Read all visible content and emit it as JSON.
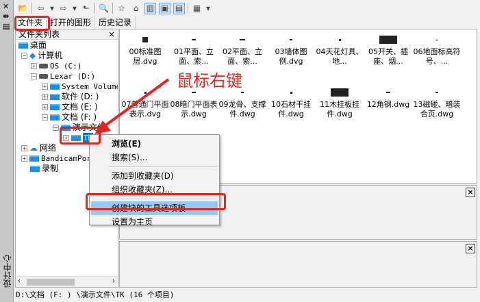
{
  "sidebar_strip": {
    "vertical_title": "设计中心"
  },
  "tabs": [
    {
      "label": "文件夹"
    },
    {
      "label": "打开的图形"
    },
    {
      "label": "历史记录"
    }
  ],
  "tree": {
    "header": "文件夹列表",
    "close": "×",
    "nodes": [
      {
        "label": "桌面"
      },
      {
        "label": "计算机"
      },
      {
        "label": "OS (C:)"
      },
      {
        "label": "Lexar (D:)"
      },
      {
        "label": "System Volume"
      },
      {
        "label": "软件 (D: )"
      },
      {
        "label": "文档 (E: )"
      },
      {
        "label": "文档 (F: )"
      },
      {
        "label": "演示文件"
      },
      {
        "label": "TK"
      },
      {
        "label": "网络"
      },
      {
        "label": "BandicamPor"
      },
      {
        "label": "录制"
      }
    ]
  },
  "content": {
    "items": [
      {
        "label": "00标准图层.dvg"
      },
      {
        "label": "01平面、立面、索..."
      },
      {
        "label": "02平面、立面、索..."
      },
      {
        "label": "03墙体图例.dvg"
      },
      {
        "label": "04天花灯具、地..."
      },
      {
        "label": "05开关、插座、烟..."
      },
      {
        "label": "06地面标高符号、..."
      },
      {
        "label": "07普通门平面表示.dvg"
      },
      {
        "label": "08暗门平面表示.dwg"
      },
      {
        "label": "09龙骨、支撑件.dwg"
      },
      {
        "label": "10石材干挂件.dwg"
      },
      {
        "label": "11木挂板挂件.dwg"
      },
      {
        "label": "12角钢.dwg"
      },
      {
        "label": "13磁碰、暗装合页.dwg"
      }
    ]
  },
  "context_menu": {
    "items": [
      {
        "label": "浏览(E)"
      },
      {
        "label": "搜索(S)..."
      },
      {
        "label": "添加到收藏夹(D)"
      },
      {
        "label": "组织收藏夹(Z)..."
      },
      {
        "label": "创建块的工具选项板"
      },
      {
        "label": "设置为主页"
      }
    ]
  },
  "annotation": "鼠标右键",
  "status": "D:\\文档 (F: ) \\演示文件\\TK (16 个项目)",
  "close": "×",
  "colors": {
    "accent": "#e8231f",
    "highlight": "#91c9f7"
  }
}
